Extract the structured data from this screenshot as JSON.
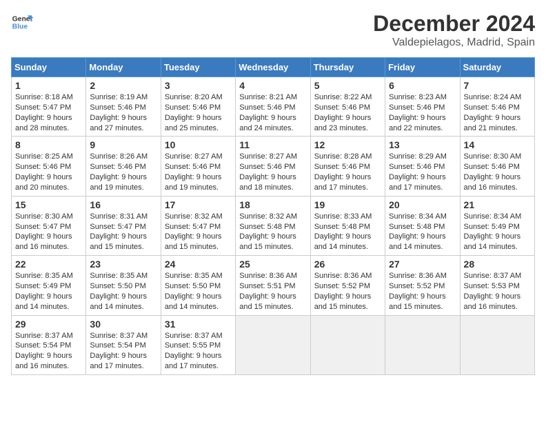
{
  "header": {
    "logo_line1": "General",
    "logo_line2": "Blue",
    "title": "December 2024",
    "subtitle": "Valdepielagos, Madrid, Spain"
  },
  "days_of_week": [
    "Sunday",
    "Monday",
    "Tuesday",
    "Wednesday",
    "Thursday",
    "Friday",
    "Saturday"
  ],
  "weeks": [
    [
      {
        "day": 1,
        "sunrise": "8:18 AM",
        "sunset": "5:47 PM",
        "daylight": "9 hours and 28 minutes."
      },
      {
        "day": 2,
        "sunrise": "8:19 AM",
        "sunset": "5:46 PM",
        "daylight": "9 hours and 27 minutes."
      },
      {
        "day": 3,
        "sunrise": "8:20 AM",
        "sunset": "5:46 PM",
        "daylight": "9 hours and 25 minutes."
      },
      {
        "day": 4,
        "sunrise": "8:21 AM",
        "sunset": "5:46 PM",
        "daylight": "9 hours and 24 minutes."
      },
      {
        "day": 5,
        "sunrise": "8:22 AM",
        "sunset": "5:46 PM",
        "daylight": "9 hours and 23 minutes."
      },
      {
        "day": 6,
        "sunrise": "8:23 AM",
        "sunset": "5:46 PM",
        "daylight": "9 hours and 22 minutes."
      },
      {
        "day": 7,
        "sunrise": "8:24 AM",
        "sunset": "5:46 PM",
        "daylight": "9 hours and 21 minutes."
      }
    ],
    [
      {
        "day": 8,
        "sunrise": "8:25 AM",
        "sunset": "5:46 PM",
        "daylight": "9 hours and 20 minutes."
      },
      {
        "day": 9,
        "sunrise": "8:26 AM",
        "sunset": "5:46 PM",
        "daylight": "9 hours and 19 minutes."
      },
      {
        "day": 10,
        "sunrise": "8:27 AM",
        "sunset": "5:46 PM",
        "daylight": "9 hours and 19 minutes."
      },
      {
        "day": 11,
        "sunrise": "8:27 AM",
        "sunset": "5:46 PM",
        "daylight": "9 hours and 18 minutes."
      },
      {
        "day": 12,
        "sunrise": "8:28 AM",
        "sunset": "5:46 PM",
        "daylight": "9 hours and 17 minutes."
      },
      {
        "day": 13,
        "sunrise": "8:29 AM",
        "sunset": "5:46 PM",
        "daylight": "9 hours and 17 minutes."
      },
      {
        "day": 14,
        "sunrise": "8:30 AM",
        "sunset": "5:46 PM",
        "daylight": "9 hours and 16 minutes."
      }
    ],
    [
      {
        "day": 15,
        "sunrise": "8:30 AM",
        "sunset": "5:47 PM",
        "daylight": "9 hours and 16 minutes."
      },
      {
        "day": 16,
        "sunrise": "8:31 AM",
        "sunset": "5:47 PM",
        "daylight": "9 hours and 15 minutes."
      },
      {
        "day": 17,
        "sunrise": "8:32 AM",
        "sunset": "5:47 PM",
        "daylight": "9 hours and 15 minutes."
      },
      {
        "day": 18,
        "sunrise": "8:32 AM",
        "sunset": "5:48 PM",
        "daylight": "9 hours and 15 minutes."
      },
      {
        "day": 19,
        "sunrise": "8:33 AM",
        "sunset": "5:48 PM",
        "daylight": "9 hours and 14 minutes."
      },
      {
        "day": 20,
        "sunrise": "8:34 AM",
        "sunset": "5:48 PM",
        "daylight": "9 hours and 14 minutes."
      },
      {
        "day": 21,
        "sunrise": "8:34 AM",
        "sunset": "5:49 PM",
        "daylight": "9 hours and 14 minutes."
      }
    ],
    [
      {
        "day": 22,
        "sunrise": "8:35 AM",
        "sunset": "5:49 PM",
        "daylight": "9 hours and 14 minutes."
      },
      {
        "day": 23,
        "sunrise": "8:35 AM",
        "sunset": "5:50 PM",
        "daylight": "9 hours and 14 minutes."
      },
      {
        "day": 24,
        "sunrise": "8:35 AM",
        "sunset": "5:50 PM",
        "daylight": "9 hours and 14 minutes."
      },
      {
        "day": 25,
        "sunrise": "8:36 AM",
        "sunset": "5:51 PM",
        "daylight": "9 hours and 15 minutes."
      },
      {
        "day": 26,
        "sunrise": "8:36 AM",
        "sunset": "5:52 PM",
        "daylight": "9 hours and 15 minutes."
      },
      {
        "day": 27,
        "sunrise": "8:36 AM",
        "sunset": "5:52 PM",
        "daylight": "9 hours and 15 minutes."
      },
      {
        "day": 28,
        "sunrise": "8:37 AM",
        "sunset": "5:53 PM",
        "daylight": "9 hours and 16 minutes."
      }
    ],
    [
      {
        "day": 29,
        "sunrise": "8:37 AM",
        "sunset": "5:54 PM",
        "daylight": "9 hours and 16 minutes."
      },
      {
        "day": 30,
        "sunrise": "8:37 AM",
        "sunset": "5:54 PM",
        "daylight": "9 hours and 17 minutes."
      },
      {
        "day": 31,
        "sunrise": "8:37 AM",
        "sunset": "5:55 PM",
        "daylight": "9 hours and 17 minutes."
      },
      null,
      null,
      null,
      null
    ]
  ]
}
